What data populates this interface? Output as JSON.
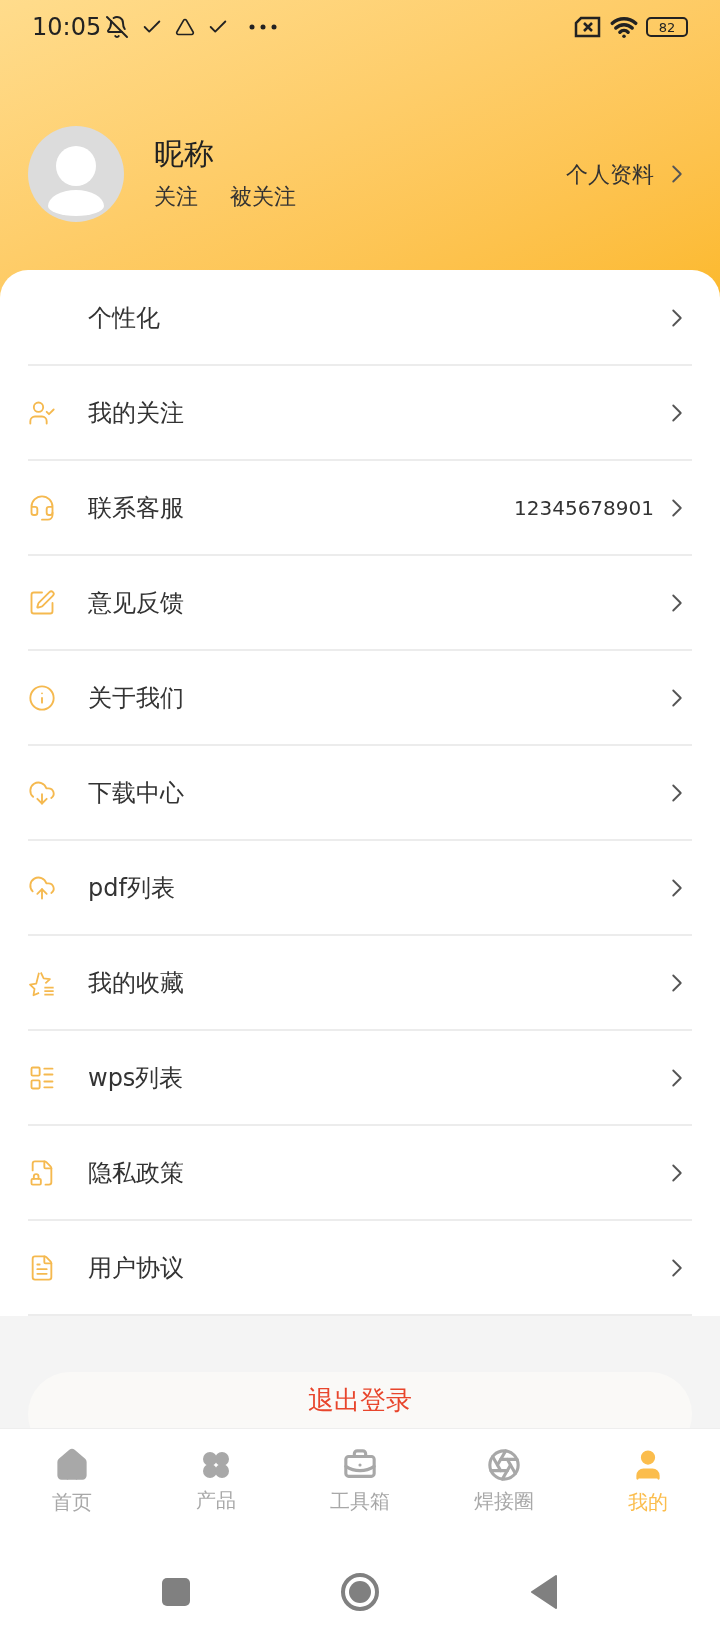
{
  "status_bar": {
    "time": "10:05",
    "battery": "82"
  },
  "profile": {
    "nickname": "昵称",
    "following": "关注",
    "followers": "被关注",
    "profile_link": "个人资料"
  },
  "menu": [
    {
      "label": "个性化"
    },
    {
      "label": "我的关注"
    },
    {
      "label": "联系客服",
      "value": "12345678901"
    },
    {
      "label": "意见反馈"
    },
    {
      "label": "关于我们"
    },
    {
      "label": "下载中心"
    },
    {
      "label": "pdf列表"
    },
    {
      "label": "我的收藏"
    },
    {
      "label": "wps列表"
    },
    {
      "label": "隐私政策"
    },
    {
      "label": "用户协议"
    }
  ],
  "logout": "退出登录",
  "tabs": [
    {
      "label": "首页",
      "selected": false
    },
    {
      "label": "产品",
      "selected": false
    },
    {
      "label": "工具箱",
      "selected": false
    },
    {
      "label": "焊接圈",
      "selected": false
    },
    {
      "label": "我的",
      "selected": true
    }
  ]
}
